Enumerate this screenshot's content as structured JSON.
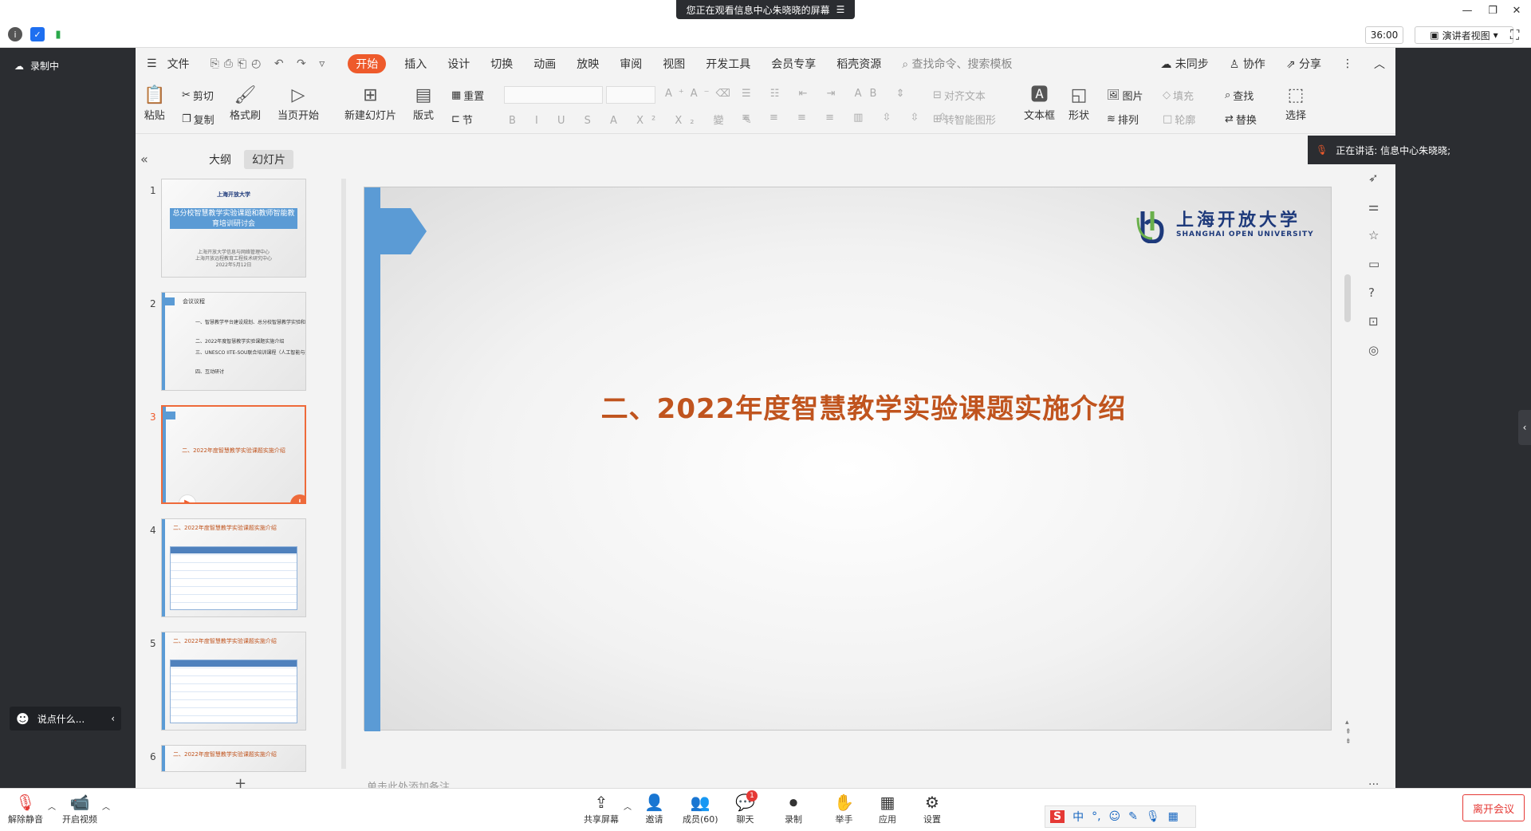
{
  "banner": {
    "text": "您正在观看信息中心朱晓晓的屏幕",
    "menu_icon": "menu-lines-icon"
  },
  "window_controls": {
    "minimize": "—",
    "restore": "❐",
    "close": "✕"
  },
  "infobar": {
    "timer": "36:00",
    "presenter_view": "演讲者视图"
  },
  "left_overlay": {
    "recording": "录制中",
    "chat_placeholder": "说点什么..."
  },
  "menubar": {
    "items": [
      "文件",
      "开始",
      "插入",
      "设计",
      "切换",
      "动画",
      "放映",
      "审阅",
      "视图",
      "开发工具",
      "会员专享",
      "稻壳资源"
    ],
    "active": "开始",
    "search_placeholder": "查找命令、搜索模板",
    "sync": "未同步",
    "collab": "协作",
    "share": "分享"
  },
  "ribbon": {
    "paste": "粘贴",
    "cut": "剪切",
    "copy": "复制",
    "format_painter": "格式刷",
    "start_from_current": "当页开始",
    "new_slide": "新建幻灯片",
    "layout": "版式",
    "section": "节",
    "reset": "重置",
    "align_text": "对齐文本",
    "smart_shape": "转智能图形",
    "textbox": "文本框",
    "shape": "形状",
    "picture": "图片",
    "arrange": "排列",
    "fill": "填充",
    "outline": "轮廓",
    "find": "查找",
    "replace": "替换",
    "select": "选择"
  },
  "pane": {
    "tabs": [
      "大纲",
      "幻灯片"
    ],
    "active_tab": "幻灯片",
    "slides": [
      {
        "num": "1",
        "title": "总分校智慧教学实验课题和教师智能教育培训研讨会",
        "sub": [
          "上海开放大学信息与网络管理中心",
          "上海开放远程教育工程技术研究中心",
          "2022年5月12日"
        ],
        "logo": "上海开放大学"
      },
      {
        "num": "2",
        "heading": "会议议程",
        "items": [
          "一、智慧教学平台建设规划、总分校智慧教学实验和教师智能教育等活动介绍",
          "二、2022年度智慧教学实验课题实施介绍",
          "三、UNESCO IITE-SOU联合培训课程（人工智能与数字教育创新能力教师发展）实施介绍",
          "四、互动研讨"
        ]
      },
      {
        "num": "3",
        "title": "二、2022年度智慧教学实验课题实施介绍"
      },
      {
        "num": "4",
        "heading": "二、2022年度智慧教学实验课题实施介绍"
      },
      {
        "num": "5",
        "heading": "二、2022年度智慧教学实验课题实施介绍"
      },
      {
        "num": "6",
        "heading": "二、2022年度智慧教学实验课题实施介绍"
      }
    ],
    "selected": "3"
  },
  "slide": {
    "title": "二、2022年度智慧教学实验课题实施介绍",
    "logo_cn": "上海开放大学",
    "logo_en": "SHANGHAI OPEN UNIVERSITY"
  },
  "notes_placeholder": "单击此处添加备注",
  "talking": {
    "text": "正在讲话: 信息中心朱晓晓;"
  },
  "bottom": {
    "unmute": "解除静音",
    "video": "开启视频",
    "share": "共享屏幕",
    "invite": "邀请",
    "members": "成员(60)",
    "chat": "聊天",
    "chat_badge": "1",
    "record": "录制",
    "raise_hand": "举手",
    "apps": "应用",
    "settings": "设置",
    "leave": "离开会议"
  },
  "ime": {
    "mode": "中"
  },
  "colors": {
    "accent": "#ee5a2b",
    "slide_blue": "#5b9bd5",
    "title_orange": "#c0541e",
    "logo_navy": "#1e3a7b"
  }
}
